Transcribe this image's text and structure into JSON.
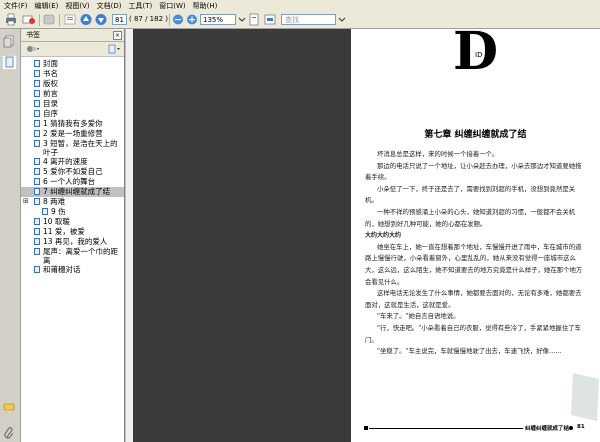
{
  "menu": [
    "文件(F)",
    "编辑(E)",
    "视图(V)",
    "文档(D)",
    "工具(T)",
    "窗口(W)",
    "帮助(H)"
  ],
  "toolbar": {
    "current_page": "81",
    "page_total": "( 87 / 182 )",
    "zoom": "135%",
    "search_placeholder": "查找"
  },
  "panel": {
    "title": "书签",
    "close": "×",
    "bookmarks": [
      {
        "label": "封面",
        "expander": ""
      },
      {
        "label": "书名",
        "expander": ""
      },
      {
        "label": "版权",
        "expander": ""
      },
      {
        "label": "前言",
        "expander": ""
      },
      {
        "label": "目录",
        "expander": ""
      },
      {
        "label": "自序",
        "expander": ""
      },
      {
        "label": "1 猜猜我有多爱你",
        "expander": ""
      },
      {
        "label": "2 爱是一场重修营",
        "expander": ""
      },
      {
        "label": "3 短暂，是浩在天上的叶子",
        "expander": "",
        "wrap": true
      },
      {
        "label": "4 离开的速度",
        "expander": ""
      },
      {
        "label": "5 爱你不如爱自己",
        "expander": ""
      },
      {
        "label": "6 一个人的舞台",
        "expander": ""
      },
      {
        "label": "7 纠缠纠缠就成了结",
        "expander": "",
        "selected": true
      },
      {
        "label": "8 两难",
        "expander": "⊞"
      },
      {
        "label": "9 伤",
        "expander": "",
        "indent": true
      },
      {
        "label": "10 取暖",
        "expander": ""
      },
      {
        "label": "11 爱，被爱",
        "expander": ""
      },
      {
        "label": "13 再见，我的爱人",
        "expander": ""
      },
      {
        "label": "尾声：离爱一个巾的距离",
        "expander": "",
        "wrap": true
      },
      {
        "label": "和莆穗对话",
        "expander": ""
      }
    ]
  },
  "page": {
    "dropcap": "D",
    "dropcap_mark": "ID",
    "chapter_title": "第七章  纠缠纠缠就成了结",
    "paragraphs": [
      {
        "text": "坏消息总是这样，来的时候一个接着一个。",
        "style": ""
      },
      {
        "text": "那边的电话只说了一个地址，让小朵赶去办理，小朵去那边才知道要她拖着手续。",
        "style": ""
      },
      {
        "text": "小朵怔了一下，终于还是去了，需要找到刘超的手机，没想到竟然是关机。",
        "style": ""
      },
      {
        "text": "一种不祥的预感涌上小朵的心头，她知道刘超的习惯，一般都不会关机的，她想到好几种可能，她的心都在发颤。",
        "style": ""
      },
      {
        "text": "大约大约大约",
        "style": "sub"
      },
      {
        "text": "她坐在车上，她一直在想着那个地址，车慢慢开进了雨中，车在城市的道路上慢慢行驶，小朵看着窗外，心里乱乱的，她从来没有觉得一座城市这么大，这么远，这么陌生，她不知道要去的地方究竟是什么样子，她在那个地方会看见什么。",
        "style": ""
      },
      {
        "text": "这样电话无论发生了什么事情，她都要去面对的，无论有多难，她都要去面对，这就是生活，这就是爱。",
        "style": ""
      },
      {
        "text": "\"车来了。\"她自言自语地说。",
        "style": ""
      },
      {
        "text": "\"行，快走吧。\"小朵看着自己的衣服，觉得有些冷了，手紧紧地握住了车门。",
        "style": ""
      },
      {
        "text": "\"坐稳了。\"车主说完，车就慢慢地驶了出去，车速飞快，好像……",
        "style": ""
      }
    ],
    "footer_title": "纠缠纠缠就成了结",
    "page_number": "81"
  },
  "colors": {
    "chrome": "#ece9d8",
    "viewer_bg": "#3a3a3a",
    "accent": "#3a6fb6"
  }
}
